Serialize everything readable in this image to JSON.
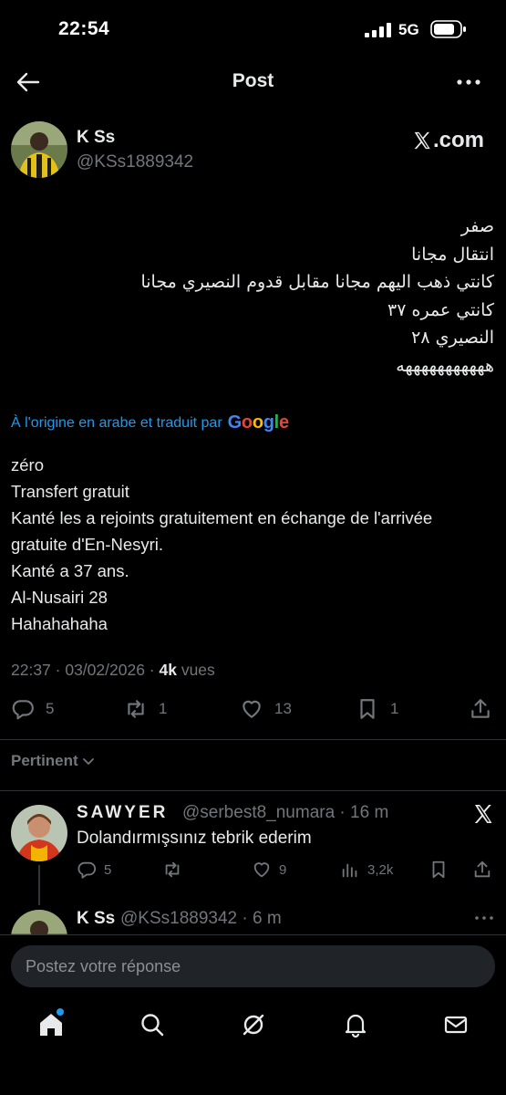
{
  "status_bar": {
    "time": "22:54",
    "network": "5G"
  },
  "header": {
    "title": "Post"
  },
  "author": {
    "name": "K Ss",
    "handle": "@KSs1889342"
  },
  "watermark": ".com",
  "post": {
    "arabic_lines": [
      "صفر",
      "انتقال مجانا",
      "كانتي ذهب اليهم مجانا مقابل قدوم النصيري مجانا",
      "كانتي عمره ٣٧",
      "النصيري ٢٨",
      "هههههههههههه"
    ],
    "translate_label": "À l'origine en arabe et traduit par",
    "translate_brand": "Google",
    "translation_lines": [
      "zéro",
      "Transfert gratuit",
      "Kanté les a rejoints gratuitement en échange de l'arrivée",
      "gratuite d'En-Nesyri.",
      "Kanté a 37 ans.",
      "Al-Nusairi 28",
      "Hahahahaha"
    ],
    "timestamp": "22:37 · 03/02/2026 · ",
    "views_count": "4k",
    "views_label": " vues",
    "replies": "5",
    "reposts": "1",
    "likes": "13",
    "bookmarks": "1"
  },
  "sort_label": "Pertinent",
  "reply": {
    "name": "SAWYER",
    "handle": "@serbest8_numara · 16 m",
    "text": "Dolandırmışsınız tebrik ederim",
    "replies": "5",
    "likes": "9",
    "views": "3,2k"
  },
  "reply2": {
    "name": "K Ss",
    "handle": "@KSs1889342 · 6 m"
  },
  "composer": {
    "placeholder": "Postez votre réponse"
  },
  "colors": {
    "accent": "#1d9bf0",
    "muted": "#71767b",
    "text": "#e7e9ea",
    "background": "#000000"
  }
}
